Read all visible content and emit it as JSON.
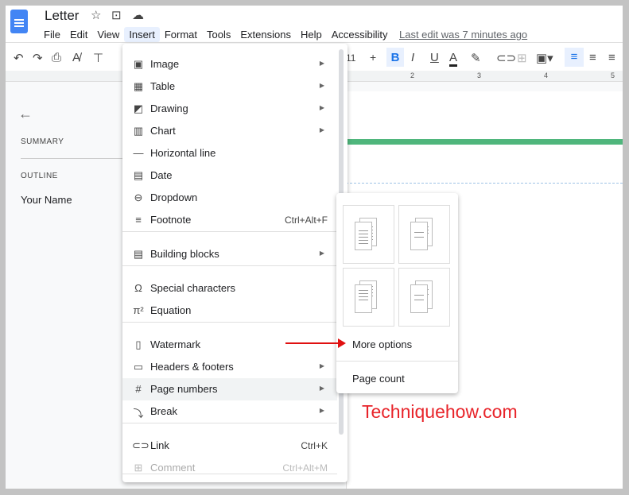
{
  "doc": {
    "title": "Letter",
    "last_edit": "Last edit was 7 minutes ago"
  },
  "menubar": [
    "File",
    "Edit",
    "View",
    "Insert",
    "Format",
    "Tools",
    "Extensions",
    "Help",
    "Accessibility"
  ],
  "toolbar": {
    "font_size": "11",
    "plus": "+",
    "bold": "B",
    "italic": "I",
    "underline": "U",
    "text_color": "A"
  },
  "ruler": [
    "2",
    "3",
    "4",
    "5"
  ],
  "sidebar": {
    "summary": "SUMMARY",
    "outline": "OUTLINE",
    "heading": "Your Name"
  },
  "insert_menu": [
    {
      "icon": "image-icon",
      "glyph": "▣",
      "label": "Image",
      "submenu": true
    },
    {
      "icon": "table-icon",
      "glyph": "▦",
      "label": "Table",
      "submenu": true
    },
    {
      "icon": "drawing-icon",
      "glyph": "◩",
      "label": "Drawing",
      "submenu": true
    },
    {
      "icon": "chart-icon",
      "glyph": "▥",
      "label": "Chart",
      "submenu": true
    },
    {
      "icon": "horizontal-line-icon",
      "glyph": "—",
      "label": "Horizontal line"
    },
    {
      "icon": "date-icon",
      "glyph": "▤",
      "label": "Date"
    },
    {
      "icon": "dropdown-icon",
      "glyph": "⊖",
      "label": "Dropdown"
    },
    {
      "icon": "footnote-icon",
      "glyph": "≡",
      "label": "Footnote",
      "shortcut": "Ctrl+Alt+F"
    },
    {
      "icon": "building-blocks-icon",
      "glyph": "▤",
      "label": "Building blocks",
      "submenu": true
    },
    {
      "icon": "omega-icon",
      "glyph": "Ω",
      "label": "Special characters"
    },
    {
      "icon": "pi-icon",
      "glyph": "π²",
      "label": "Equation"
    },
    {
      "icon": "watermark-icon",
      "glyph": "▯",
      "label": "Watermark"
    },
    {
      "icon": "headers-footers-icon",
      "glyph": "▭",
      "label": "Headers & footers",
      "submenu": true
    },
    {
      "icon": "hash-icon",
      "glyph": "#",
      "label": "Page numbers",
      "submenu": true,
      "highlighted": true
    },
    {
      "icon": "break-icon",
      "glyph": "⤵",
      "label": "Break",
      "submenu": true
    },
    {
      "icon": "link-icon",
      "glyph": "⊂⊃",
      "label": "Link",
      "shortcut": "Ctrl+K"
    },
    {
      "icon": "comment-icon",
      "glyph": "⊞",
      "label": "Comment",
      "shortcut": "Ctrl+Alt+M",
      "disabled": true
    }
  ],
  "page_numbers_submenu": {
    "more_options": "More options",
    "page_count": "Page count"
  },
  "watermark": "Techniquehow.com",
  "colors": {
    "accent": "#1a73e8",
    "green_bar": "#4fb67c",
    "annotation": "#e01010"
  }
}
